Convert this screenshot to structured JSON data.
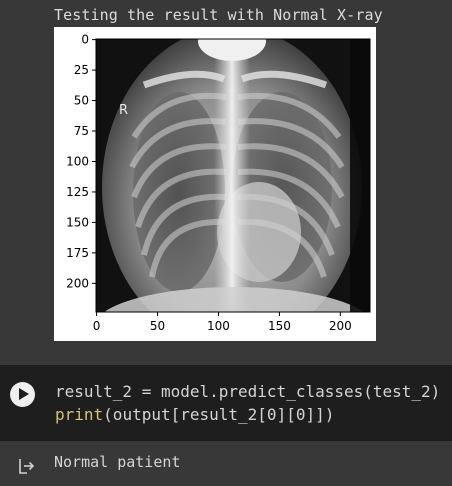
{
  "output_title": "Testing the result with Normal X-ray",
  "figure": {
    "image_marker": "R",
    "y_ticks": [
      "0",
      "25",
      "50",
      "75",
      "100",
      "125",
      "150",
      "175",
      "200"
    ],
    "x_ticks": [
      "0",
      "50",
      "100",
      "150",
      "200"
    ],
    "image_size": "224x224"
  },
  "code": {
    "line1": "result_2 = model.predict_classes(test_2)",
    "line2_func": "print",
    "line2_rest": "(output[result_2[0][0]])"
  },
  "output_text": "Normal patient",
  "icons": {
    "run": "play-circle-icon",
    "output": "output-arrow-icon"
  },
  "colors": {
    "background": "#383838",
    "code_background": "#1e1e1e",
    "keyword": "#d6c27a"
  }
}
